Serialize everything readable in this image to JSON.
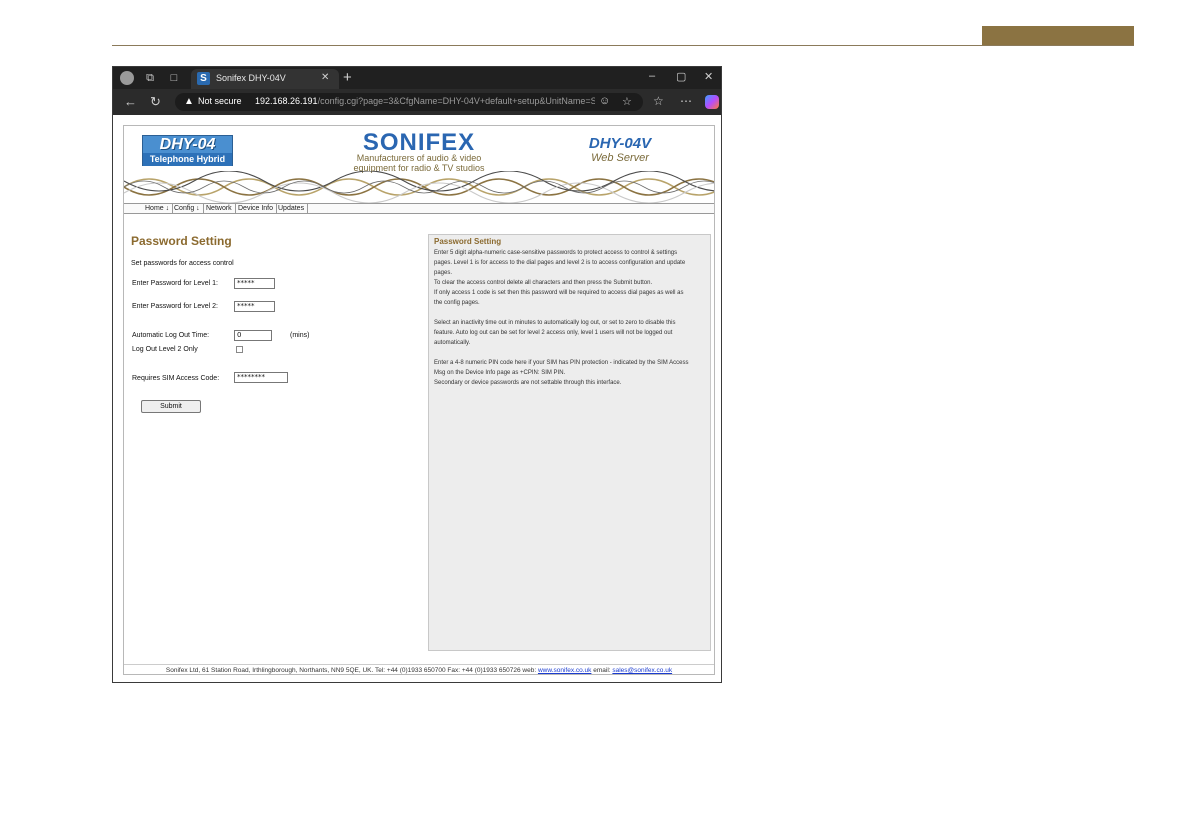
{
  "browser": {
    "tab_title": "Sonifex DHY-04V",
    "tab_favicon_letter": "S",
    "security_label": "Not secure",
    "url_host": "192.168.26.191",
    "url_path": "/config.cgi?page=3&CfgName=DHY-04V+default+setup&UnitName=So..."
  },
  "header": {
    "logo_title": "DHY-04",
    "logo_subtitle": "Telephone Hybrid",
    "brand": "SONIFEX",
    "brand_tagline_1": "Manufacturers of audio & video",
    "brand_tagline_2": "equipment for radio & TV studios",
    "product": "DHY-04V",
    "product_sub": "Web Server"
  },
  "menu": {
    "items": [
      {
        "label": "Home ↓"
      },
      {
        "label": "Config ↓"
      },
      {
        "label": "Network"
      },
      {
        "label": "Device Info"
      },
      {
        "label": "Updates"
      }
    ]
  },
  "form": {
    "title": "Password Setting",
    "subtitle": "Set passwords for access control",
    "level1_label": "Enter Password for Level 1:",
    "level1_value": "*****",
    "level2_label": "Enter Password for Level 2:",
    "level2_value": "*****",
    "logout_label": "Automatic Log Out Time:",
    "logout_value": "0",
    "logout_unit": "(mins)",
    "logout_level2_label": "Log Out Level 2 Only",
    "sim_label": "Requires SIM Access Code:",
    "sim_value": "********",
    "submit_label": "Submit"
  },
  "help": {
    "title": "Password Setting",
    "lines": [
      "Enter 5 digit alpha-numeric case-sensitive passwords to protect access to control & settings",
      "pages. Level 1 is for access to the dial pages and level 2 is to access configuration and update",
      "pages.",
      "To clear the access control delete all characters and then press the Submit button.",
      "If only access 1 code is set then this password will be required to access dial pages as well as",
      "the config pages.",
      "",
      "Select an inactivity time out in minutes to automatically log out, or set to zero to disable this",
      "feature. Auto log out can be set for level 2 access only, level 1 users will not be logged out",
      "automatically.",
      "",
      "Enter a 4-8 numeric PIN code here if your SIM has PIN protection - indicated by the SIM Access",
      "Msg on the Device Info page as +CPIN: SIM PIN.",
      "Secondary or device passwords are not settable through this interface."
    ]
  },
  "footer": {
    "text": "Sonifex Ltd, 61 Station Road, Irthlingborough, Northants, NN9 5QE, UK. Tel: +44 (0)1933 650700 Fax: +44 (0)1933 650726 web: ",
    "web_link": "www.sonifex.co.uk",
    "email_text": " email: ",
    "email_link": "sales@sonifex.co.uk"
  }
}
